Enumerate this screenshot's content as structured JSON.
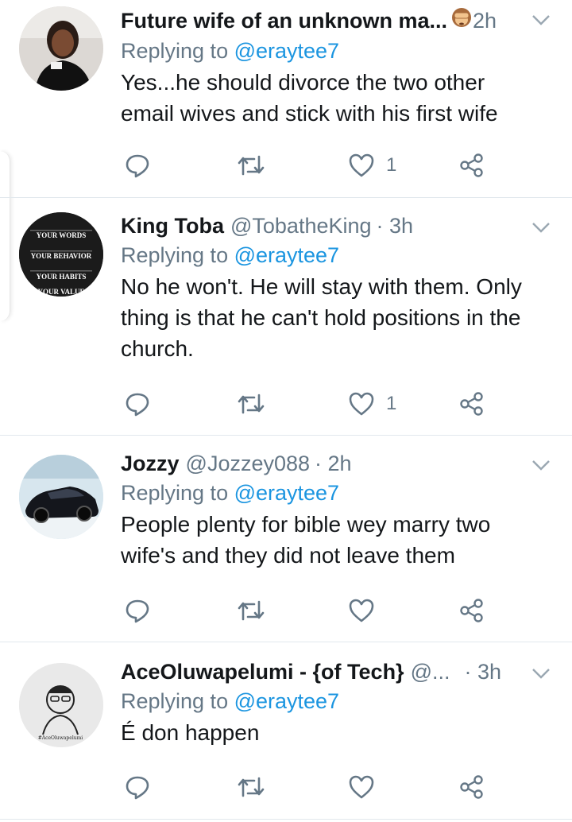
{
  "colors": {
    "accent": "#1b95e0",
    "secondary_text": "#657786",
    "primary_text": "#14171a",
    "divider": "#e1e8ed"
  },
  "tweets": [
    {
      "name": "Future wife of an unknown ma...",
      "handle": "",
      "time": "2h",
      "emoji_icon": "see-no-evil-monkey-icon",
      "replying_prefix": "Replying to ",
      "replying_to": "@eraytee7",
      "text": "Yes...he should divorce the two other email wives and stick with his first wife",
      "like_count": "1"
    },
    {
      "name": "King Toba",
      "handle": "@TobatheKing",
      "time": "· 3h",
      "replying_prefix": "Replying to ",
      "replying_to": "@eraytee7",
      "text": "No he won't. He will stay with them. Only thing is that he can't hold positions in the church.",
      "like_count": "1",
      "avatar_lines": [
        "YOUR WORDS",
        "YOUR BEHAVIOR",
        "YOUR HABITS",
        "YOUR VALUE"
      ]
    },
    {
      "name": "Jozzy",
      "handle": "@Jozzey088",
      "time": "· 2h",
      "replying_prefix": "Replying to ",
      "replying_to": "@eraytee7",
      "text": "People plenty for bible wey marry two wife's and they did not leave them",
      "like_count": ""
    },
    {
      "name": "AceOluwapelumi - {of Tech}",
      "handle": "@...",
      "time": "· 3h",
      "replying_prefix": "Replying to ",
      "replying_to": "@eraytee7",
      "text": "É don happen",
      "like_count": "",
      "avatar_caption": "#AceOluwapelumi"
    }
  ]
}
